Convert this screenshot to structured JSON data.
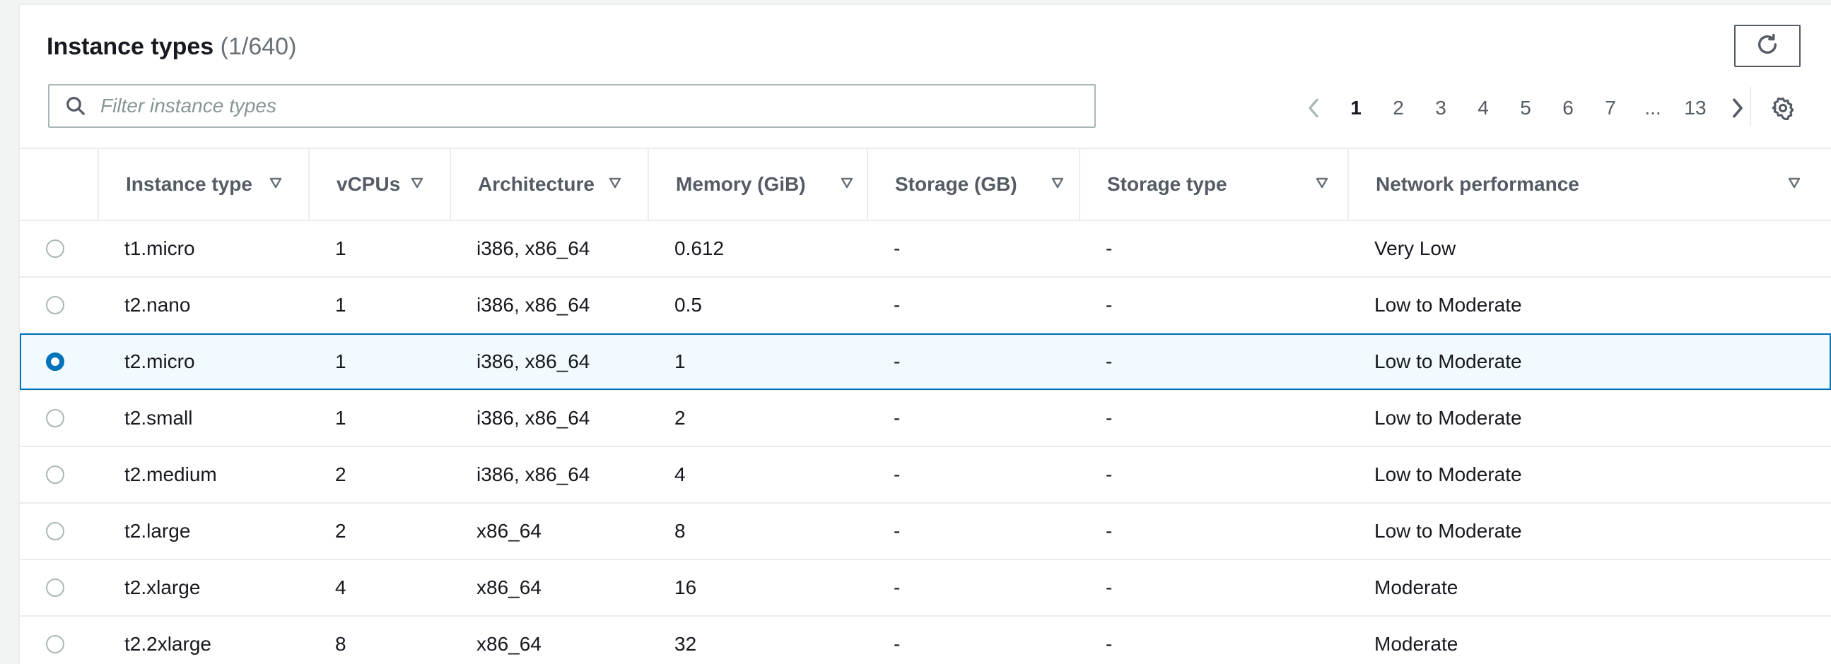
{
  "header": {
    "title": "Instance types",
    "count": "(1/640)"
  },
  "search": {
    "placeholder": "Filter instance types",
    "value": ""
  },
  "pagination": {
    "pages": [
      "1",
      "2",
      "3",
      "4",
      "5",
      "6",
      "7",
      "...",
      "13"
    ],
    "current": "1"
  },
  "icons": {
    "refresh": "refresh-icon",
    "search": "search-icon",
    "prev": "chevron-left-icon",
    "next": "chevron-right-icon",
    "settings": "gear-icon",
    "sort": "caret-down-outline-icon"
  },
  "colors": {
    "accent": "#0073bb",
    "selected_row_bg": "#f1faff",
    "border": "#eaeded",
    "muted_text": "#687078"
  },
  "table": {
    "columns": [
      "Instance type",
      "vCPUs",
      "Architecture",
      "Memory (GiB)",
      "Storage (GB)",
      "Storage type",
      "Network performance"
    ],
    "rows": [
      {
        "selected": false,
        "cells": [
          "t1.micro",
          "1",
          "i386, x86_64",
          "0.612",
          "-",
          "-",
          "Very Low"
        ]
      },
      {
        "selected": false,
        "cells": [
          "t2.nano",
          "1",
          "i386, x86_64",
          "0.5",
          "-",
          "-",
          "Low to Moderate"
        ]
      },
      {
        "selected": true,
        "cells": [
          "t2.micro",
          "1",
          "i386, x86_64",
          "1",
          "-",
          "-",
          "Low to Moderate"
        ]
      },
      {
        "selected": false,
        "cells": [
          "t2.small",
          "1",
          "i386, x86_64",
          "2",
          "-",
          "-",
          "Low to Moderate"
        ]
      },
      {
        "selected": false,
        "cells": [
          "t2.medium",
          "2",
          "i386, x86_64",
          "4",
          "-",
          "-",
          "Low to Moderate"
        ]
      },
      {
        "selected": false,
        "cells": [
          "t2.large",
          "2",
          "x86_64",
          "8",
          "-",
          "-",
          "Low to Moderate"
        ]
      },
      {
        "selected": false,
        "cells": [
          "t2.xlarge",
          "4",
          "x86_64",
          "16",
          "-",
          "-",
          "Moderate"
        ]
      },
      {
        "selected": false,
        "cells": [
          "t2.2xlarge",
          "8",
          "x86_64",
          "32",
          "-",
          "-",
          "Moderate"
        ]
      }
    ]
  }
}
